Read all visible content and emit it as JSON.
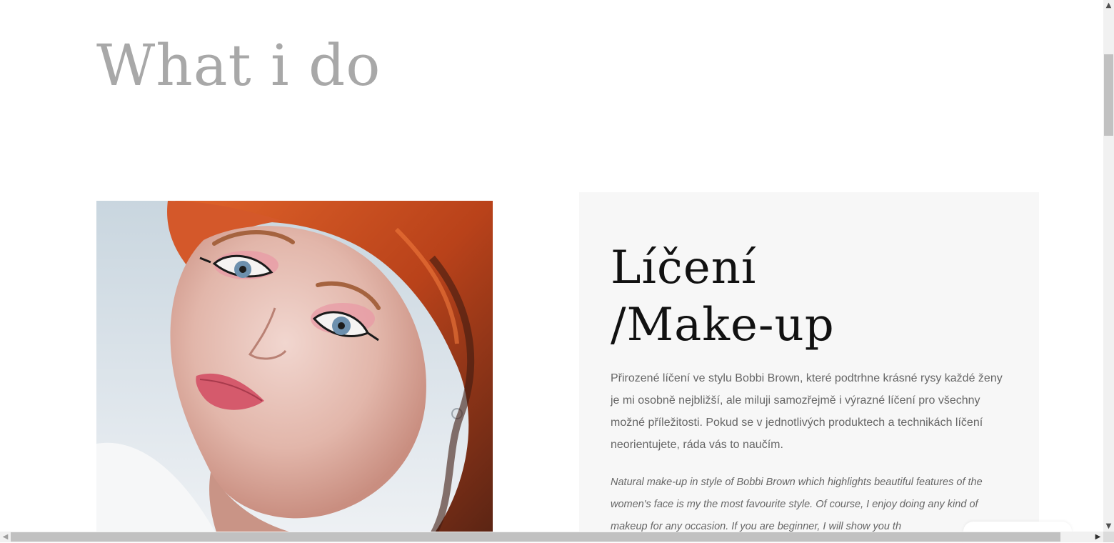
{
  "section": {
    "title": "What i do"
  },
  "service": {
    "title_line1": "Líčení",
    "title_line2": "/Make-up",
    "text_cz": "Přirozené líčení ve stylu Bobbi Brown, které podtrhne krásné rysy každé ženy je mi osobně nejbližší, ale miluji samozřejmě i výrazné líčení pro všechny možné příležitosti. Pokud se v jednotlivých produktech a technikách líčení neorientujete, ráda vás to naučím.",
    "text_en": "Natural make-up in style of Bobbi Brown which highlights beautiful features of the women's face is my the most favourite style. Of course, I enjoy doing any kind of makeup for any occasion. If you are beginner, I will show you th"
  },
  "colors": {
    "title_gray": "#a8a8a8",
    "card_bg": "#f7f7f7",
    "body_text": "#666666",
    "heading_text": "#111111"
  },
  "icons": {
    "scroll_up": "chevron-up-icon",
    "scroll_down": "chevron-down-icon",
    "scroll_left": "chevron-left-icon",
    "scroll_right": "chevron-right-icon"
  }
}
